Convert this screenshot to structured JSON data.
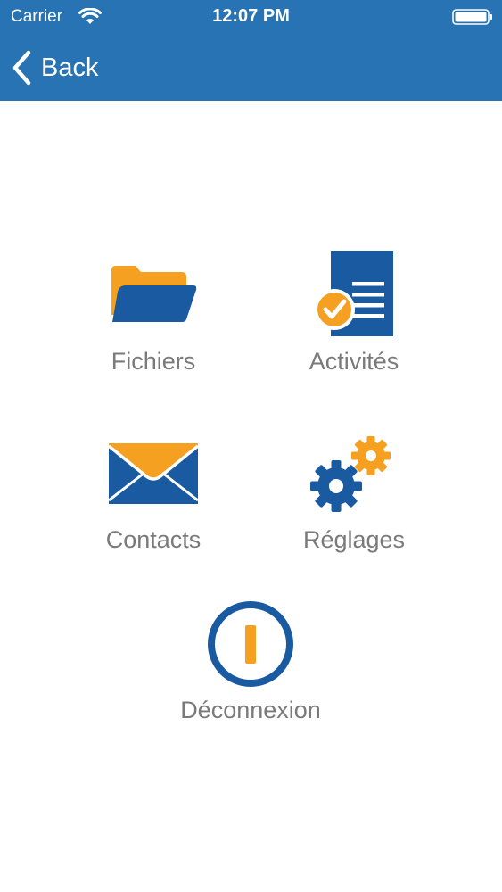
{
  "status_bar": {
    "carrier": "Carrier",
    "time": "12:07 PM",
    "icons": [
      "wifi-icon",
      "battery-icon"
    ]
  },
  "nav": {
    "back_label": "Back",
    "back_icon": "chevron-left-icon"
  },
  "menu": {
    "items": [
      {
        "label": "Fichiers",
        "icon": "folder-icon"
      },
      {
        "label": "Activités",
        "icon": "document-check-icon"
      },
      {
        "label": "Contacts",
        "icon": "envelope-icon"
      },
      {
        "label": "Réglages",
        "icon": "gears-icon"
      },
      {
        "label": "Déconnexion",
        "icon": "power-icon"
      }
    ]
  },
  "colors": {
    "brand_blue": "#2773b3",
    "icon_blue": "#1a5aa0",
    "accent_orange": "#f5a021",
    "label_gray": "#7a7a7a",
    "background": "#ffffff"
  }
}
